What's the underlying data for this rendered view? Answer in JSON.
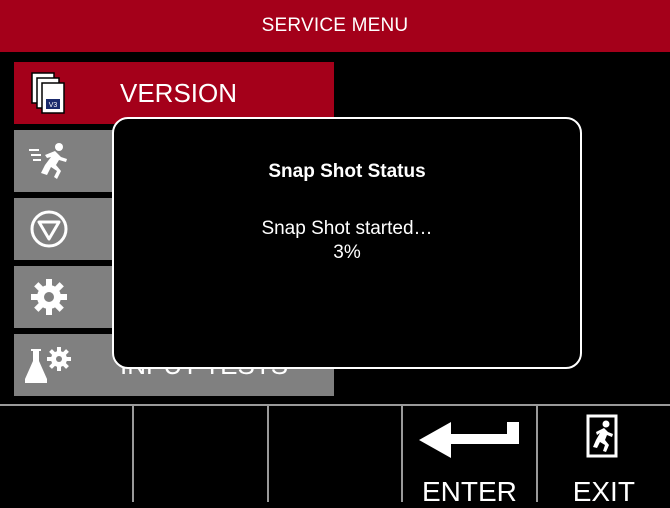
{
  "header": {
    "title": "SERVICE MENU"
  },
  "menu": {
    "items": [
      {
        "label": "VERSION",
        "icon": "version-document-icon",
        "active": true
      },
      {
        "label": "",
        "icon": "running-person-icon",
        "active": false
      },
      {
        "label": "",
        "icon": "stop-triangle-icon",
        "active": false
      },
      {
        "label": "",
        "icon": "gear-icon",
        "active": false
      },
      {
        "label": "INPUT TESTS",
        "icon": "flask-gear-icon",
        "active": false
      }
    ]
  },
  "dialog": {
    "title": "Snap Shot Status",
    "message": "Snap Shot started…",
    "progress": "3%"
  },
  "footer": {
    "buttons": [
      {
        "label": "",
        "icon": ""
      },
      {
        "label": "",
        "icon": ""
      },
      {
        "label": "",
        "icon": ""
      },
      {
        "label": "ENTER",
        "icon": "enter-arrow-icon"
      },
      {
        "label": "EXIT",
        "icon": "exit-door-icon"
      }
    ]
  },
  "colors": {
    "accent": "#a4001a",
    "inactive": "#808080",
    "background": "#000000",
    "text": "#ffffff"
  }
}
